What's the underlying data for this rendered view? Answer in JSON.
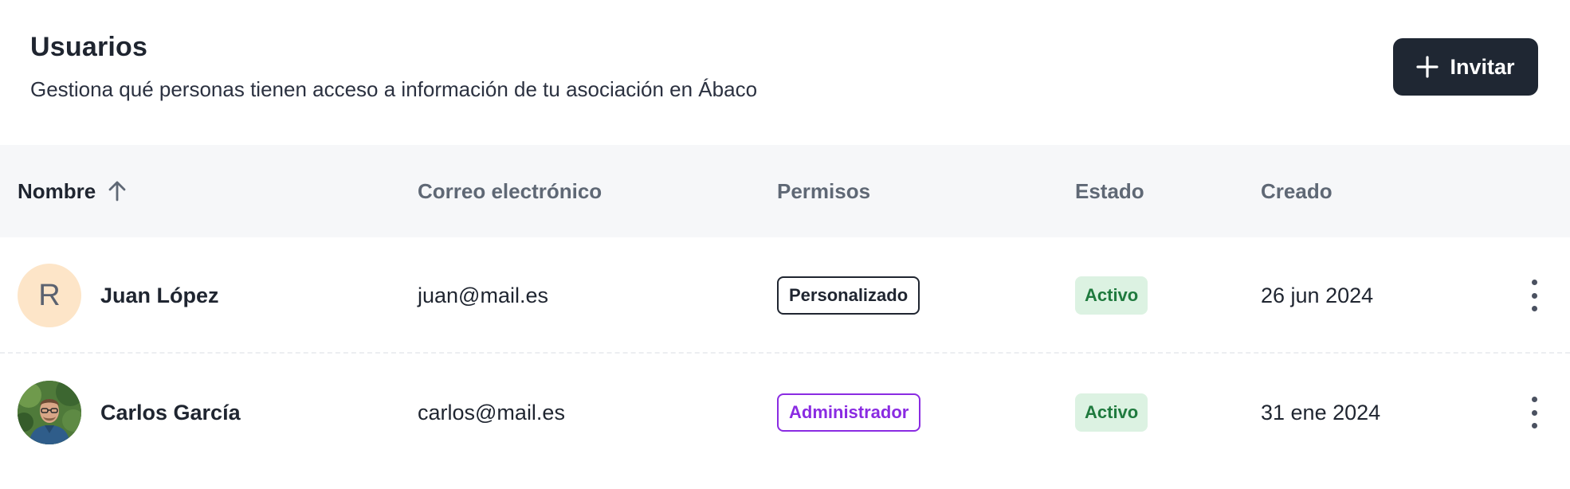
{
  "header": {
    "title": "Usuarios",
    "subtitle": "Gestiona qué personas tienen acceso a información de tu asociación en Ábaco",
    "invite_label": "Invitar"
  },
  "table": {
    "columns": {
      "name": "Nombre",
      "email": "Correo electrónico",
      "permissions": "Permisos",
      "status": "Estado",
      "created": "Creado"
    },
    "sort": {
      "column": "name",
      "direction": "ascending",
      "icon": "arrow-up-icon"
    },
    "rows": [
      {
        "avatar_initial": "R",
        "name": "Juan López",
        "email": "juan@mail.es",
        "permission": "Personalizado",
        "status": "Activo",
        "created": "26 jun 2024"
      },
      {
        "avatar_icon": "user-photo",
        "name": "Carlos García",
        "email": "carlos@mail.es",
        "permission": "Administrador",
        "status": "Activo",
        "created": "31 ene 2024"
      }
    ]
  },
  "colors": {
    "primary_button": "#1f2733",
    "status_active_bg": "#dcf2e2",
    "status_active_text": "#1f7a3e",
    "admin_badge": "#8a2be2",
    "avatar_initial_bg": "#fde5c8",
    "header_row_bg": "#f6f7f9"
  }
}
